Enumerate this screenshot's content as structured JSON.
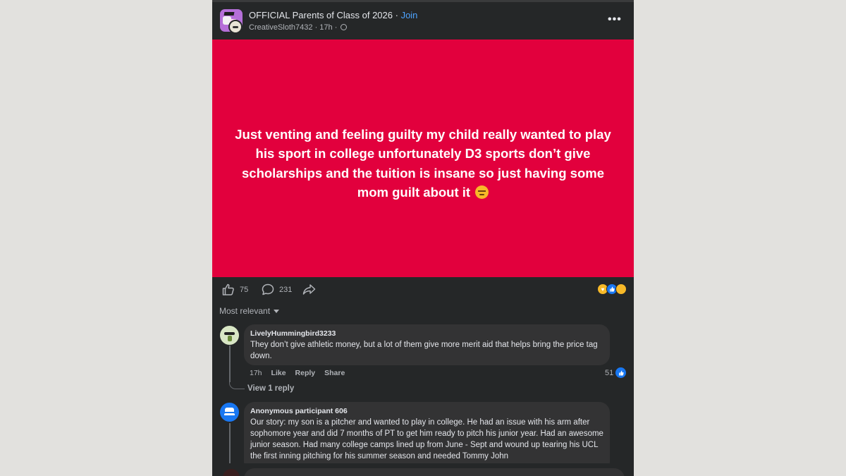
{
  "header": {
    "group_name": "OFFICIAL Parents of Class of 2026",
    "separator": " · ",
    "join_label": "Join",
    "author": "CreativeSloth7432",
    "time": "17h",
    "more_icon": "more-horizontal-icon"
  },
  "post": {
    "background_color": "#e2003d",
    "text": "Just venting and feeling guilty my child really wanted to play his sport in college unfortunately D3 sports don’t give scholarships and the tuition is insane so just having some mom guilt about it",
    "emoji": "smirking-face-emoji"
  },
  "actions": {
    "like_count": "75",
    "comment_count": "231",
    "reactions": [
      "care",
      "like",
      "sad"
    ]
  },
  "comments_sort": {
    "label": "Most relevant"
  },
  "comments": [
    {
      "author": "LivelyHummingbird3233",
      "text": "They don’t give athletic money, but a lot of them give more merit aid that helps bring the price tag down.",
      "time": "17h",
      "like_label": "Like",
      "reply_label": "Reply",
      "share_label": "Share",
      "likes": "51",
      "view_replies": "View 1 reply"
    },
    {
      "author": "Anonymous participant 606",
      "text": "Our story: my son is a pitcher and wanted to play in college. He had an issue with his arm after sophomore year and did 7 months of PT to get him ready to pitch his junior year. Had an awesome junior season. Had many college camps lined up from June - Sept and wound up tearing his UCL the first inning pitching for his summer season and needed Tommy John"
    }
  ],
  "colors": {
    "panel_bg": "#252728",
    "page_bg": "#e2e1de",
    "link": "#4da3ff",
    "like_blue": "#1877f2"
  }
}
